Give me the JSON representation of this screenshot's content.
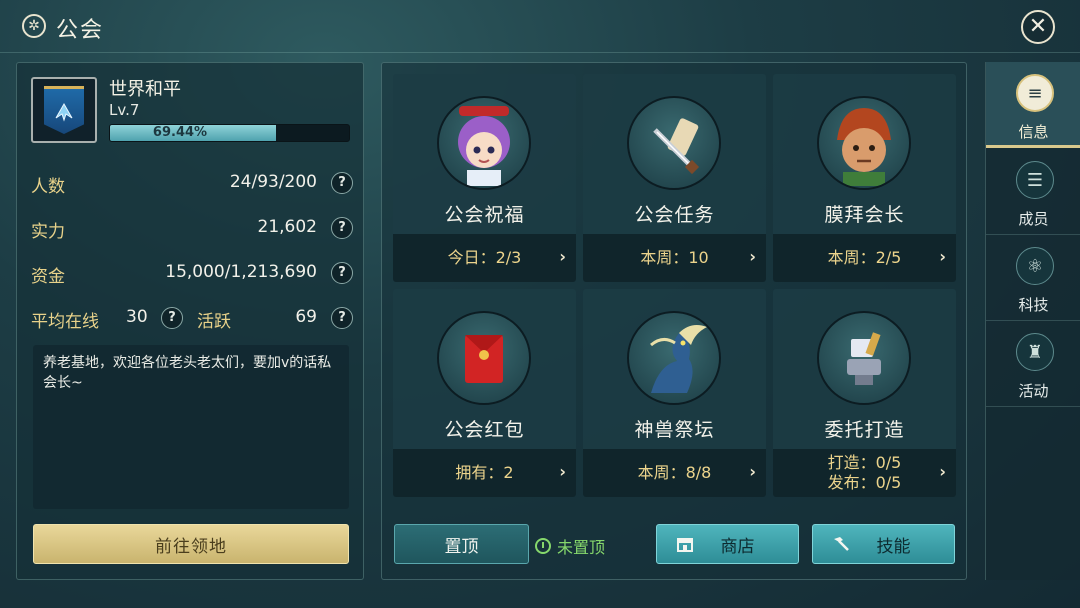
{
  "header": {
    "title": "公会",
    "guild_icon": "guild-icon",
    "close_icon": "close-icon"
  },
  "guild": {
    "name": "世界和平",
    "level": "Lv.7",
    "progress_text": "69.44%",
    "progress": 0.6944
  },
  "stats": [
    {
      "label": "人数",
      "value": "24/93/200"
    },
    {
      "label": "实力",
      "value": "21,602"
    },
    {
      "label": "资金",
      "value": "15,000/1,213,690"
    }
  ],
  "online": {
    "label": "平均在线",
    "value": "30",
    "active_label": "活跃",
    "active_value": "69"
  },
  "help_glyph": "?",
  "notice": "养老基地，欢迎各位老头老太们，要加v的话私会长~",
  "goto_button": "前往领地",
  "cards": [
    {
      "title": "公会祝福",
      "info": "今日：2/3"
    },
    {
      "title": "公会任务",
      "info": "本周：10"
    },
    {
      "title": "膜拜会长",
      "info": "本周：2/5"
    },
    {
      "title": "公会红包",
      "info": "拥有：2"
    },
    {
      "title": "神兽祭坛",
      "info": "本周：8/8"
    },
    {
      "title": "委托打造",
      "info": "打造：0/5",
      "info2": "发布：0/5"
    }
  ],
  "arrow_glyph": "›",
  "bottom": {
    "pin_button": "置顶",
    "pin_status": "未置顶",
    "shop_button": "商店",
    "skill_button": "技能"
  },
  "tabs": [
    {
      "label": "信息",
      "icon": "info-icon",
      "active": true
    },
    {
      "label": "成员",
      "icon": "members-icon",
      "active": false
    },
    {
      "label": "科技",
      "icon": "tech-icon",
      "active": false
    },
    {
      "label": "活动",
      "icon": "activity-icon",
      "active": false
    }
  ],
  "colors": {
    "accent_gold": "#e8d28a",
    "teal_button": "#3fa3ac",
    "status_green": "#86d86c"
  }
}
